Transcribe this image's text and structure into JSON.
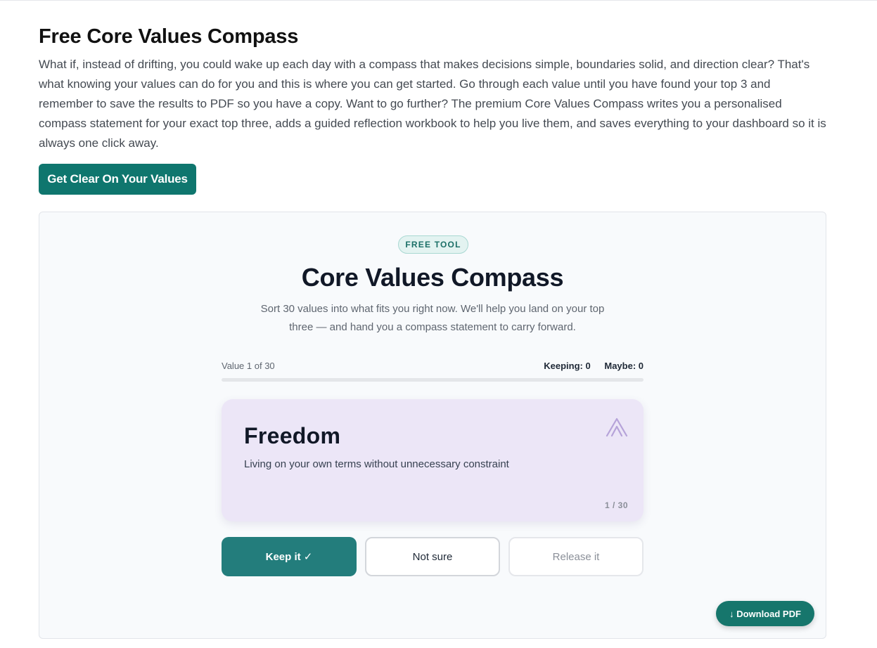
{
  "page": {
    "title": "Free Core Values Compass",
    "intro": "What if, instead of drifting, you could wake up each day with a compass that makes decisions simple, boundaries solid, and direction clear? That's what knowing your values can do for you and this is where you can get started. Go through each value until you have found your top 3 and remember to save the results to PDF so you have a copy. Want to go further? The premium Core Values Compass writes you a personalised compass statement for your exact top three, adds a guided reflection workbook to help you live them, and saves everything to your dashboard so it is always one click away.",
    "cta_label": "Get Clear On Your Values"
  },
  "tool": {
    "badge": "FREE TOOL",
    "title": "Core Values Compass",
    "subtitle": "Sort 30 values into what fits you right now. We'll help you land on your top three — and hand you a compass statement to carry forward.",
    "progress": {
      "label": "Value 1 of 30",
      "keeping": "Keeping: 0",
      "maybe": "Maybe: 0",
      "fraction": 0
    },
    "card": {
      "name": "Freedom",
      "description": "Living on your own terms without unnecessary constraint",
      "count": "1 / 30",
      "icon": "double-chevron-up-icon",
      "background": "#ece6f7",
      "icon_color": "#b6a3d9"
    },
    "actions": {
      "keep": "Keep it ✓",
      "unsure": "Not sure",
      "release": "Release it"
    },
    "download_label": "↓ Download PDF"
  },
  "colors": {
    "brand": "#0f766e",
    "keep_button": "#237d7c",
    "download_button": "#16766c"
  }
}
